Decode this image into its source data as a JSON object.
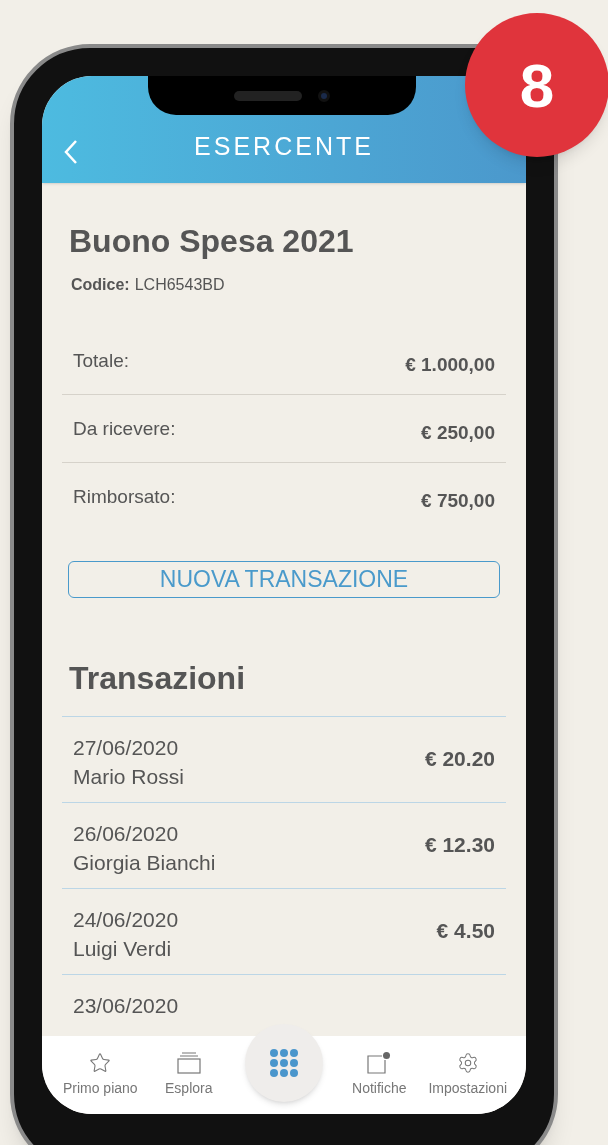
{
  "badge": "8",
  "header": {
    "title": "ESERCENTE"
  },
  "voucher": {
    "title": "Buono Spesa 2021",
    "code_label": "Codice:",
    "code": "LCH6543BD"
  },
  "summary": [
    {
      "label": "Totale:",
      "value": "€ 1.000,00"
    },
    {
      "label": "Da ricevere:",
      "value": "€ 250,00"
    },
    {
      "label": "Rimborsato:",
      "value": "€ 750,00"
    }
  ],
  "action_button": "NUOVA TRANSAZIONE",
  "transactions": {
    "title": "Transazioni",
    "rows": [
      {
        "date": "27/06/2020",
        "name": "Mario Rossi",
        "amount": "€ 20.20"
      },
      {
        "date": "26/06/2020",
        "name": "Giorgia Bianchi",
        "amount": "€ 12.30"
      },
      {
        "date": "24/06/2020",
        "name": "Luigi Verdi",
        "amount": "€ 4.50"
      },
      {
        "date": "23/06/2020"
      }
    ]
  },
  "bottom_nav": [
    {
      "kind": "star",
      "label": "Primo piano"
    },
    {
      "kind": "stack",
      "label": "Esplora"
    },
    {
      "kind": "grid"
    },
    {
      "kind": "notification",
      "label": "Notifiche"
    },
    {
      "kind": "gear",
      "label": "Impostazioni"
    }
  ]
}
